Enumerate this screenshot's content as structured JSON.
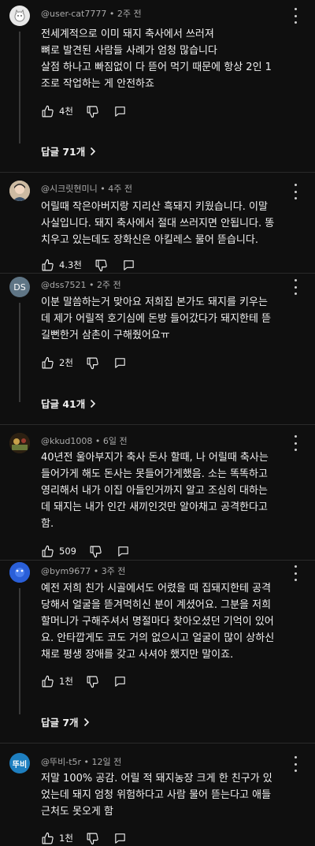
{
  "comments": [
    {
      "author": "@user-cat7777",
      "time": "2주 전",
      "text": "전세계적으로 이미 돼지 축사에서 쓰러져\n뼈로 발견된 사람들 사례가 엄청 많습니다\n살점 하나고 빠짐없이 다 뜯어 먹기 때문에 항상 2인 1\n조로 작업하는 게 안전하죠",
      "likes": "4천",
      "replies": "답글 71개"
    },
    {
      "author": "@시크릿현미니",
      "time": "4주 전",
      "text": "어릴때 작은아버지랑 지리산 흑돼지 키웠습니다. 이말\n사실입니다. 돼지 축사에서 절대 쓰러지면 안됩니다. 똥\n치우고 있는데도 장화신은 아킬레스 물어 뜯습니다.",
      "likes": "4.3천"
    },
    {
      "author": "@dss7521",
      "time": "2주 전",
      "avatar_text": "DS",
      "text": "이분 말씀하는거 맞아요 저희집 본가도 돼지를 키우는\n데 제가 어릴적 호기심에 돈방 들어갔다가 돼지한테 뜯\n길뻔한거 삼촌이 구해줬어요ㅠ",
      "likes": "2천",
      "replies": "답글 41개"
    },
    {
      "author": "@kkud1008",
      "time": "6일 전",
      "text": "40년전 울아부지가 축사 돈사 할때, 나 어릴때 축사는\n들어가게 해도 돈사는 못들어가게했음. 소는 똑똑하고\n영리해서 내가 이집 아들인거까지 알고 조심히 대하는\n데 돼지는 내가 인간 새끼인것만 알아채고 공격한다고\n함.",
      "likes": "509"
    },
    {
      "author": "@bym9677",
      "time": "3주 전",
      "text": "예전 저희 친가 시골에서도 어렸을 때 집돼지한테 공격\n당해서 얼굴을 뜯겨먹히신 분이 계셨어요. 그분을 저희\n할머니가 구해주셔서 명절마다 찾아오셨던 기억이 있어\n요. 안타깝게도 코도 거의 없으시고 얼굴이 많이 상하신\n채로 평생 장애를 갖고 사셔야 했지만 말이죠.",
      "likes": "1천",
      "replies": "답글 7개"
    },
    {
      "author": "@뚜비-t5r",
      "time": "12일 전",
      "avatar_text": "뚜비",
      "text": "저말 100% 공감. 어릴 적 돼지농장 크게 한 친구가 있\n었는데 돼지 엄청 위험하다고 사람 물어 뜯는다고 애들\n근처도 못오게 함",
      "likes": "1천"
    }
  ],
  "sep": " • ",
  "colors": {
    "background": "#0f0f0f",
    "text": "#f1f1f1",
    "meta": "#aaaaaa",
    "avatar_ds": "#5f7585",
    "avatar_ttubi": "#1e7fc0"
  }
}
